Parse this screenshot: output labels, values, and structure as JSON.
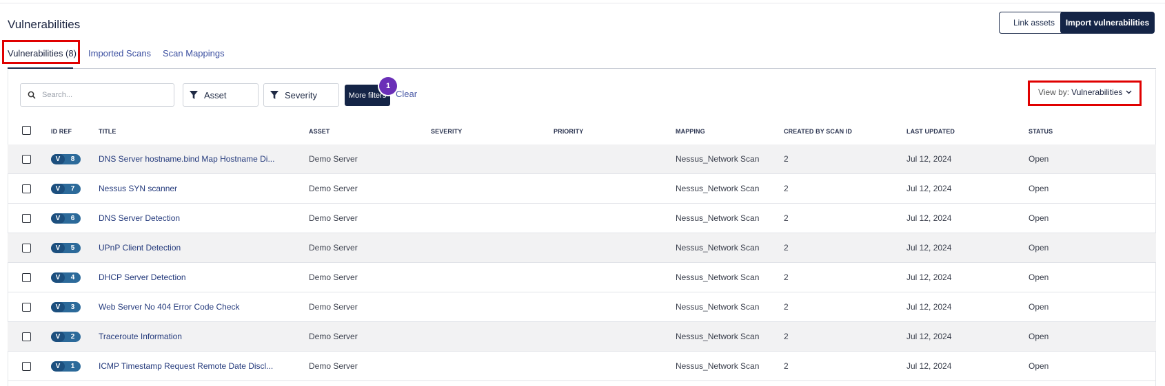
{
  "page": {
    "title": "Vulnerabilities"
  },
  "actions": {
    "link_assets": "Link assets",
    "import_vulnerabilities": "Import vulnerabilities"
  },
  "tabs": [
    {
      "label": "Vulnerabilities (8)",
      "active": true
    },
    {
      "label": "Imported Scans",
      "active": false
    },
    {
      "label": "Scan Mappings",
      "active": false
    }
  ],
  "toolbar": {
    "search_placeholder": "Search...",
    "filter_asset": "Asset",
    "filter_severity": "Severity",
    "more_filters": "More filters",
    "more_filters_count": "1",
    "clear": "Clear",
    "view_by_prefix": "View by:",
    "view_by_value": "Vulnerabilities"
  },
  "table": {
    "columns": [
      "ID REF",
      "TITLE",
      "ASSET",
      "SEVERITY",
      "PRIORITY",
      "MAPPING",
      "CREATED BY SCAN ID",
      "LAST UPDATED",
      "STATUS"
    ],
    "rows": [
      {
        "id_prefix": "V",
        "id": "8",
        "title": "DNS Server hostname.bind Map Hostname Di...",
        "asset": "Demo Server",
        "severity": "",
        "priority": "",
        "mapping": "Nessus_Network Scan",
        "scan_id": "2",
        "updated": "Jul 12, 2024",
        "status": "Open"
      },
      {
        "id_prefix": "V",
        "id": "7",
        "title": "Nessus SYN scanner",
        "asset": "Demo Server",
        "severity": "",
        "priority": "",
        "mapping": "Nessus_Network Scan",
        "scan_id": "2",
        "updated": "Jul 12, 2024",
        "status": "Open"
      },
      {
        "id_prefix": "V",
        "id": "6",
        "title": "DNS Server Detection",
        "asset": "Demo Server",
        "severity": "",
        "priority": "",
        "mapping": "Nessus_Network Scan",
        "scan_id": "2",
        "updated": "Jul 12, 2024",
        "status": "Open"
      },
      {
        "id_prefix": "V",
        "id": "5",
        "title": "UPnP Client Detection",
        "asset": "Demo Server",
        "severity": "",
        "priority": "",
        "mapping": "Nessus_Network Scan",
        "scan_id": "2",
        "updated": "Jul 12, 2024",
        "status": "Open"
      },
      {
        "id_prefix": "V",
        "id": "4",
        "title": "DHCP Server Detection",
        "asset": "Demo Server",
        "severity": "",
        "priority": "",
        "mapping": "Nessus_Network Scan",
        "scan_id": "2",
        "updated": "Jul 12, 2024",
        "status": "Open"
      },
      {
        "id_prefix": "V",
        "id": "3",
        "title": "Web Server No 404 Error Code Check",
        "asset": "Demo Server",
        "severity": "",
        "priority": "",
        "mapping": "Nessus_Network Scan",
        "scan_id": "2",
        "updated": "Jul 12, 2024",
        "status": "Open"
      },
      {
        "id_prefix": "V",
        "id": "2",
        "title": "Traceroute Information",
        "asset": "Demo Server",
        "severity": "",
        "priority": "",
        "mapping": "Nessus_Network Scan",
        "scan_id": "2",
        "updated": "Jul 12, 2024",
        "status": "Open"
      },
      {
        "id_prefix": "V",
        "id": "1",
        "title": "ICMP Timestamp Request Remote Date Discl...",
        "asset": "Demo Server",
        "severity": "",
        "priority": "",
        "mapping": "Nessus_Network Scan",
        "scan_id": "2",
        "updated": "Jul 12, 2024",
        "status": "Open"
      }
    ]
  },
  "colors": {
    "primary": "#142446",
    "badge": "#6a2fb7",
    "highlight": "#e00000",
    "id_pill": "#2c6a9a"
  },
  "icons": {
    "search": "search-icon",
    "filter": "filter-icon",
    "chevron": "chevron-down-icon"
  }
}
